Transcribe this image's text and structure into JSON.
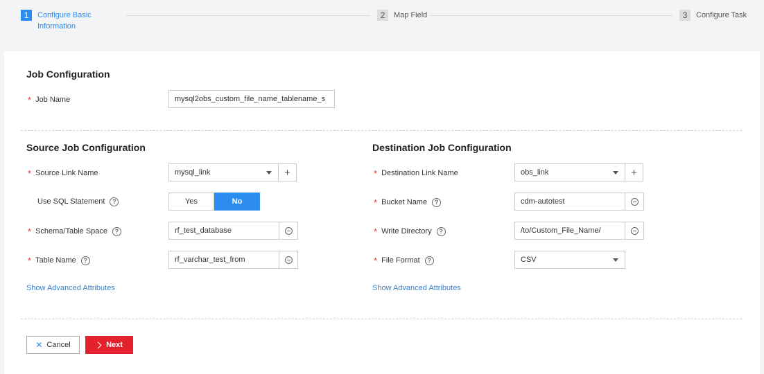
{
  "stepper": {
    "steps": [
      {
        "num": "1",
        "label_line1": "Configure Basic",
        "label_line2": "Information"
      },
      {
        "num": "2",
        "label": "Map Field"
      },
      {
        "num": "3",
        "label": "Configure Task"
      }
    ]
  },
  "job": {
    "section_title": "Job Configuration",
    "job_name_label": "Job Name",
    "job_name_value": "mysql2obs_custom_file_name_tablename_s"
  },
  "source": {
    "section_title": "Source Job Configuration",
    "link_name_label": "Source Link Name",
    "link_name_value": "mysql_link",
    "use_sql_label": "Use SQL Statement",
    "toggle_yes": "Yes",
    "toggle_no": "No",
    "schema_label": "Schema/Table Space",
    "schema_value": "rf_test_database",
    "table_label": "Table Name",
    "table_value": "rf_varchar_test_from",
    "advanced_link": "Show Advanced Attributes"
  },
  "destination": {
    "section_title": "Destination Job Configuration",
    "link_name_label": "Destination Link Name",
    "link_name_value": "obs_link",
    "bucket_label": "Bucket Name",
    "bucket_value": "cdm-autotest",
    "write_dir_label": "Write Directory",
    "write_dir_value": "/to/Custom_File_Name/",
    "file_format_label": "File Format",
    "file_format_value": "CSV",
    "advanced_link": "Show Advanced Attributes"
  },
  "footer": {
    "cancel_label": "Cancel",
    "next_label": "Next"
  },
  "icons": {
    "required": "*",
    "help": "?",
    "plus": "+",
    "close": "✕"
  },
  "colors": {
    "accent": "#2d8cf0",
    "primary_button": "#e4222e",
    "required": "#e4393c",
    "link": "#3a7fc4"
  }
}
